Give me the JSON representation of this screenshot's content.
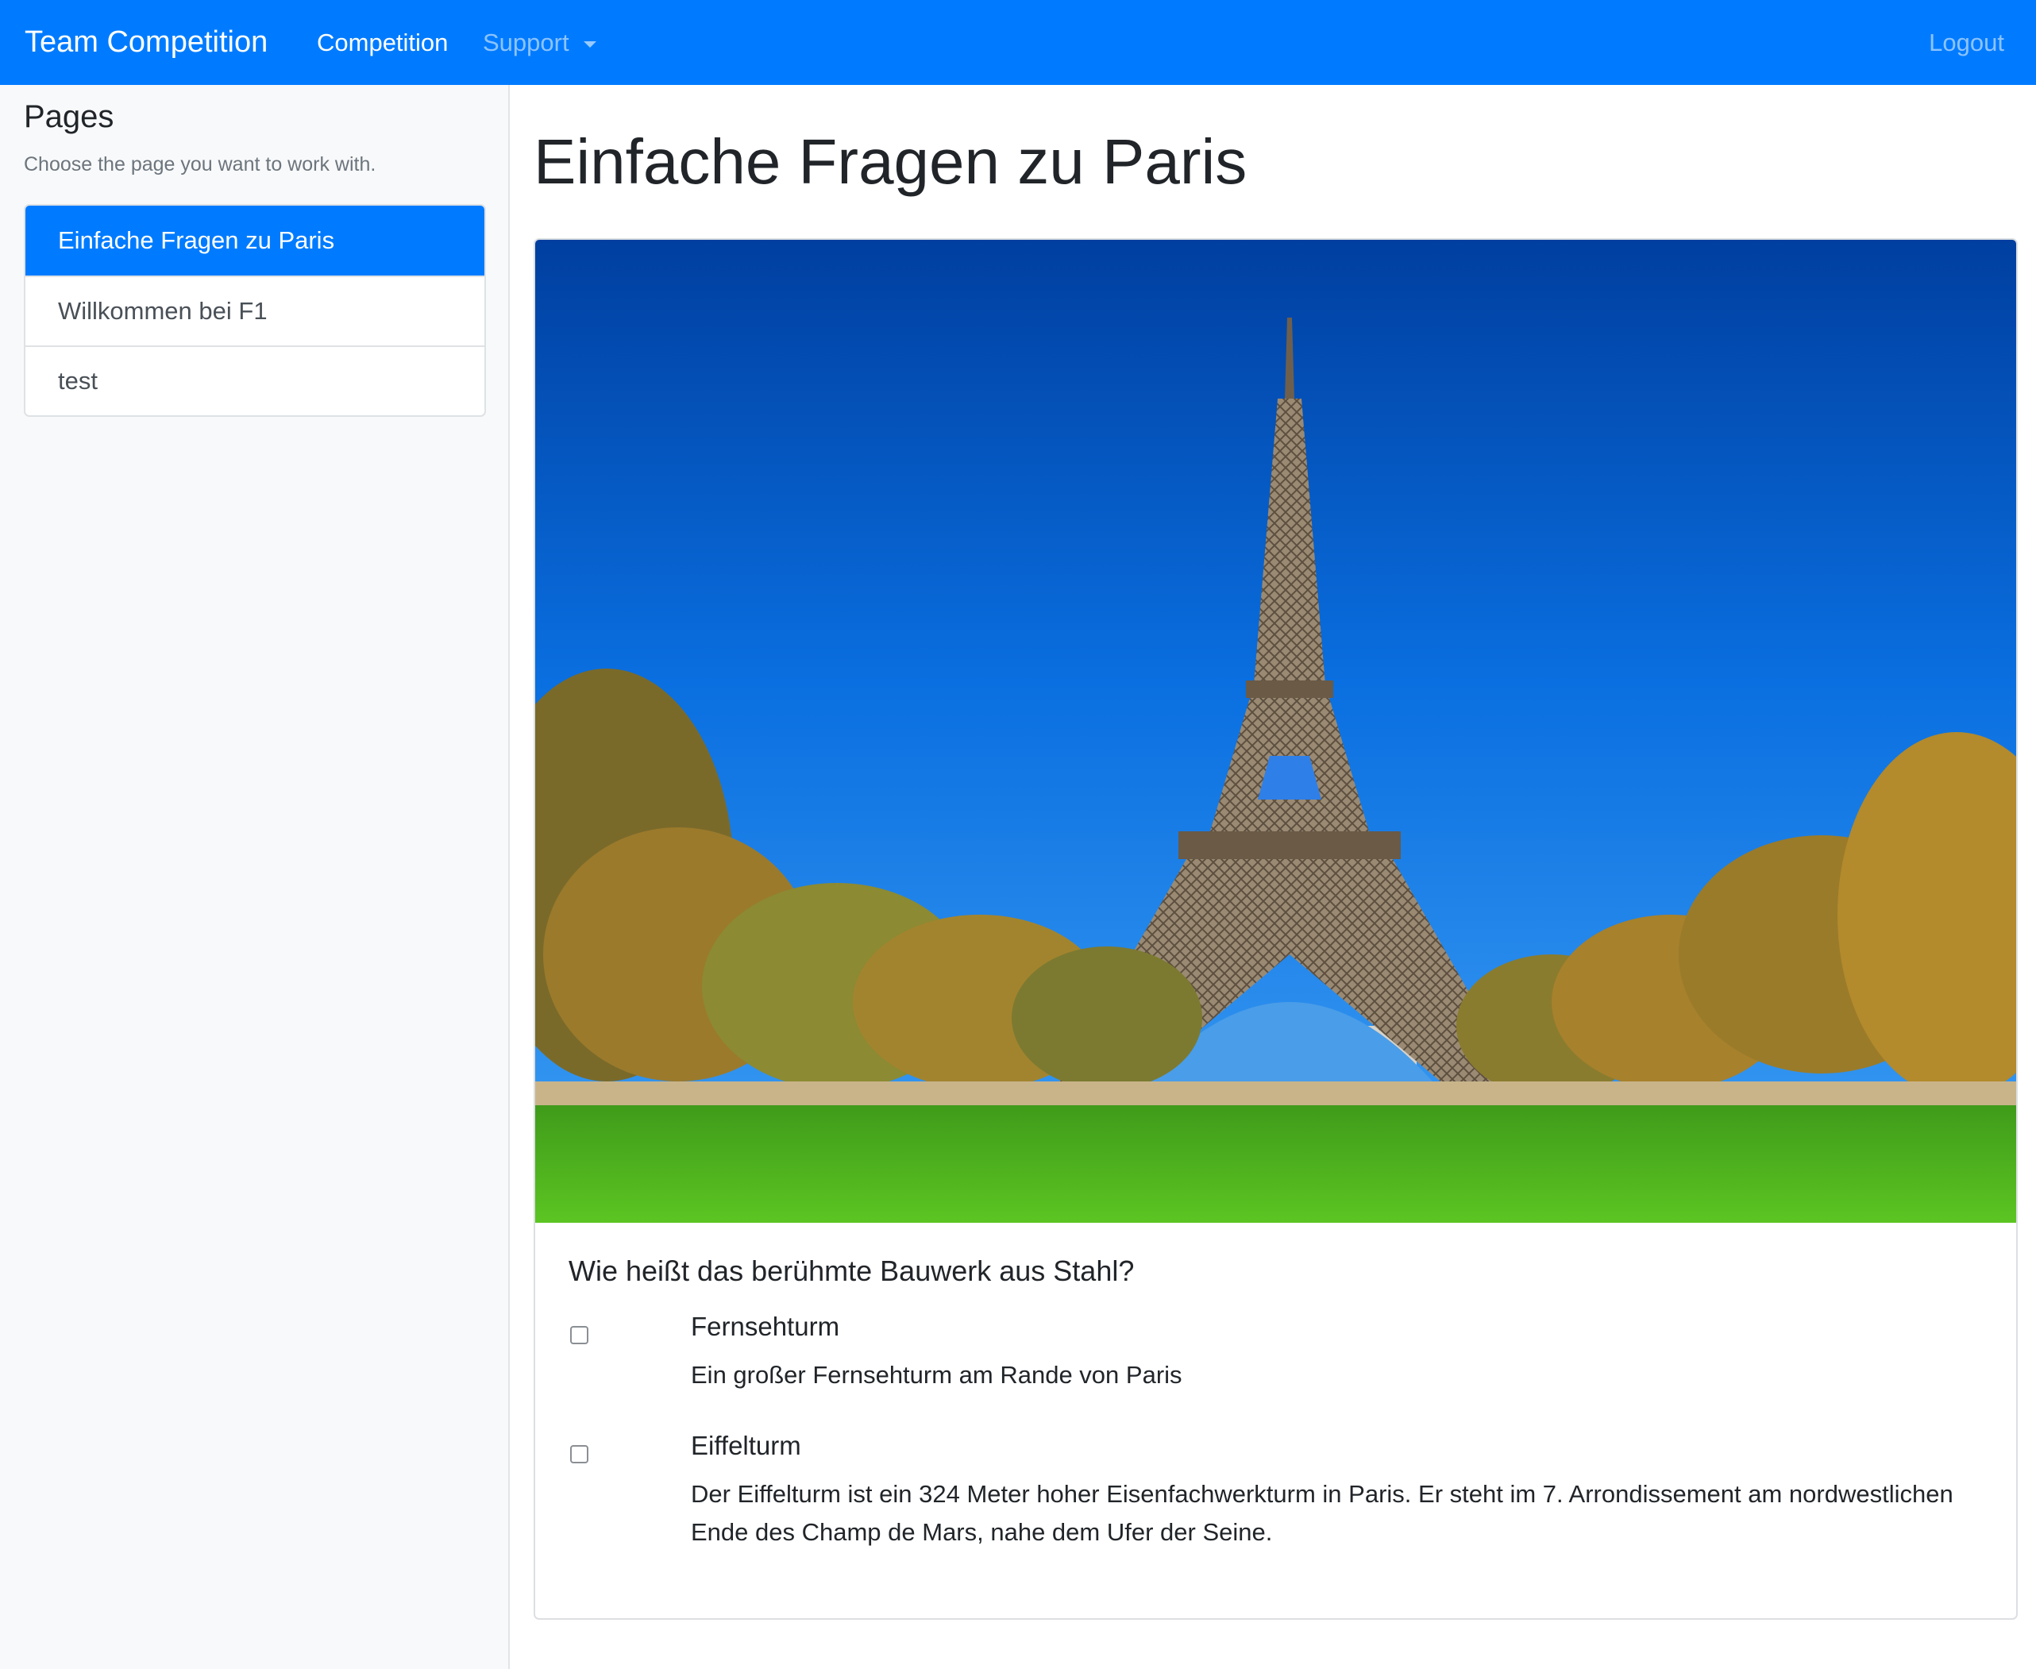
{
  "navbar": {
    "brand": "Team Competition",
    "competition": "Competition",
    "support": "Support",
    "logout": "Logout",
    "color": "#007bff"
  },
  "sidebar": {
    "title": "Pages",
    "subtitle": "Choose the page you want to work with.",
    "items": [
      {
        "label": "Einfache Fragen zu Paris",
        "active": true
      },
      {
        "label": "Willkommen bei F1",
        "active": false
      },
      {
        "label": "test",
        "active": false
      }
    ]
  },
  "main": {
    "title": "Einfache Fragen zu Paris",
    "image": "eiffel-tower-photo",
    "question": "Wie heißt das berühmte Bauwerk aus Stahl?",
    "options": [
      {
        "title": "Fernsehturm",
        "description": "Ein großer Fernsehturm am Rande von Paris",
        "checked": false
      },
      {
        "title": "Eiffelturm",
        "description": "Der Eiffelturm ist ein 324 Meter hoher Eisenfachwerkturm in Paris. Er steht im 7. Arrondissement am nordwestlichen Ende des Champ de Mars, nahe dem Ufer der Seine.",
        "checked": false
      }
    ]
  }
}
